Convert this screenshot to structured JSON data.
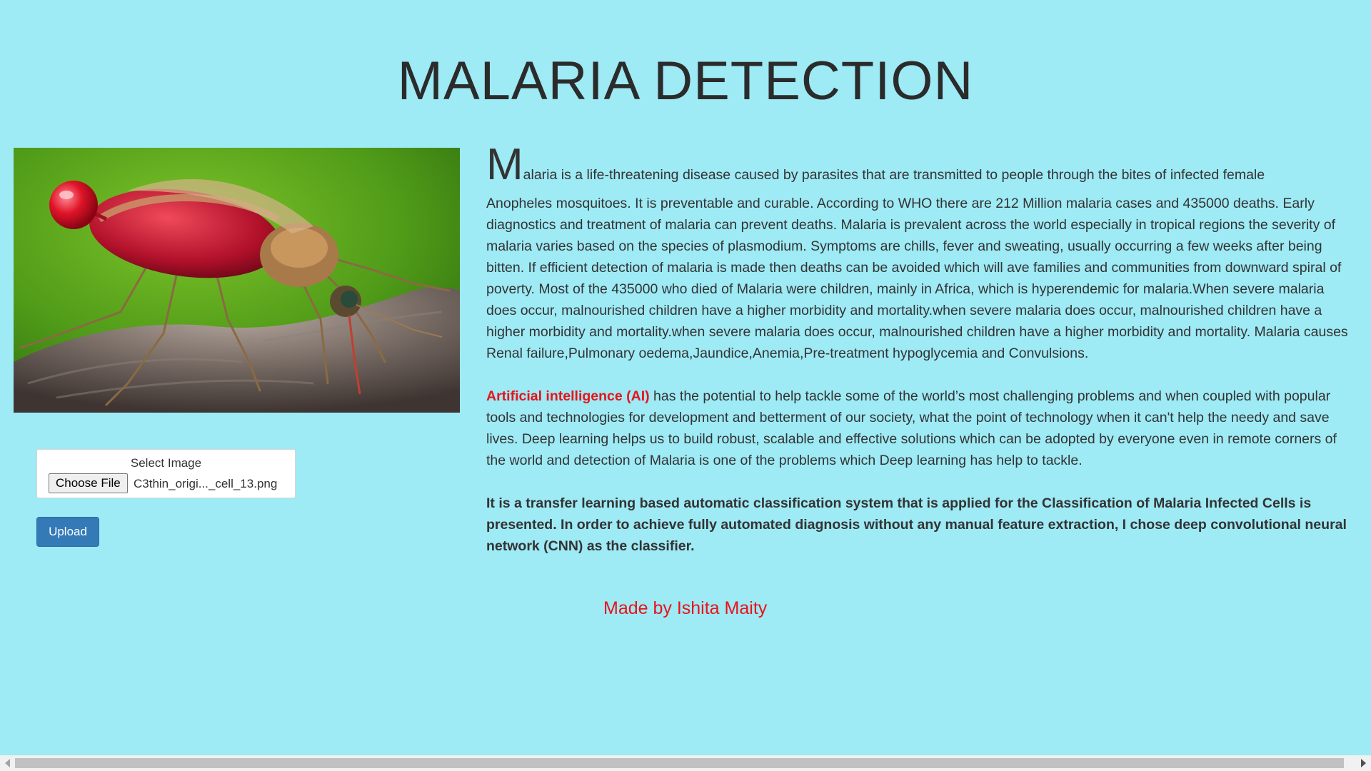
{
  "page": {
    "title": "MALARIA DETECTION"
  },
  "hero": {
    "icon": "mosquito-photo"
  },
  "upload_form": {
    "select_label": "Select Image",
    "choose_file_label": "Choose File",
    "file_name": "C3thin_origi..._cell_13.png",
    "upload_label": "Upload"
  },
  "content": {
    "intro_dropcap": "M",
    "intro_first_line": "alaria is a life-threatening disease caused by parasites that are transmitted to people through the bites of infected female",
    "intro_rest": "Anopheles mosquitoes. It is preventable and curable. According to WHO there are 212 Million malaria cases and 435000 deaths. Early diagnostics and treatment of malaria can prevent deaths. Malaria is prevalent across the world especially in tropical regions the severity of malaria varies based on the species of plasmodium. Symptoms are chills, fever and sweating, usually occurring a few weeks after being bitten. If efficient detection of malaria is made then deaths can be avoided which will ave families and communities from downward spiral of poverty. Most of the 435000 who died of Malaria were children, mainly in Africa, which is hyperendemic for malaria.When severe malaria does occur, malnourished children have a higher morbidity and mortality.when severe malaria does occur, malnourished children have a higher morbidity and mortality.when severe malaria does occur, malnourished children have a higher morbidity and mortality. Malaria causes Renal failure,Pulmonary oedema,Jaundice,Anemia,Pre-treatment hypoglycemia and Convulsions.",
    "ai_highlight": "Artificial intelligence (AI)",
    "ai_text": " has the potential to help tackle some of the world’s most challenging problems and when coupled with popular tools and technologies for development and betterment of our society, what the point of technology when it can't help the needy and save lives. Deep learning helps us to build robust, scalable and effective solutions which can be adopted by everyone even in remote corners of the world and detection of Malaria is one of the problems which Deep learning has help to tackle.",
    "method_text": "It is a transfer learning based automatic classification system that is applied for the Classification of Malaria Infected Cells is presented. In order to achieve fully automated diagnosis without any manual feature extraction, I chose deep convolutional neural network (CNN) as the classifier.",
    "credit": "Made by Ishita Maity"
  },
  "colors": {
    "background": "#9eeaf5",
    "accent_red": "#e8131a",
    "button_blue": "#337ab7"
  }
}
